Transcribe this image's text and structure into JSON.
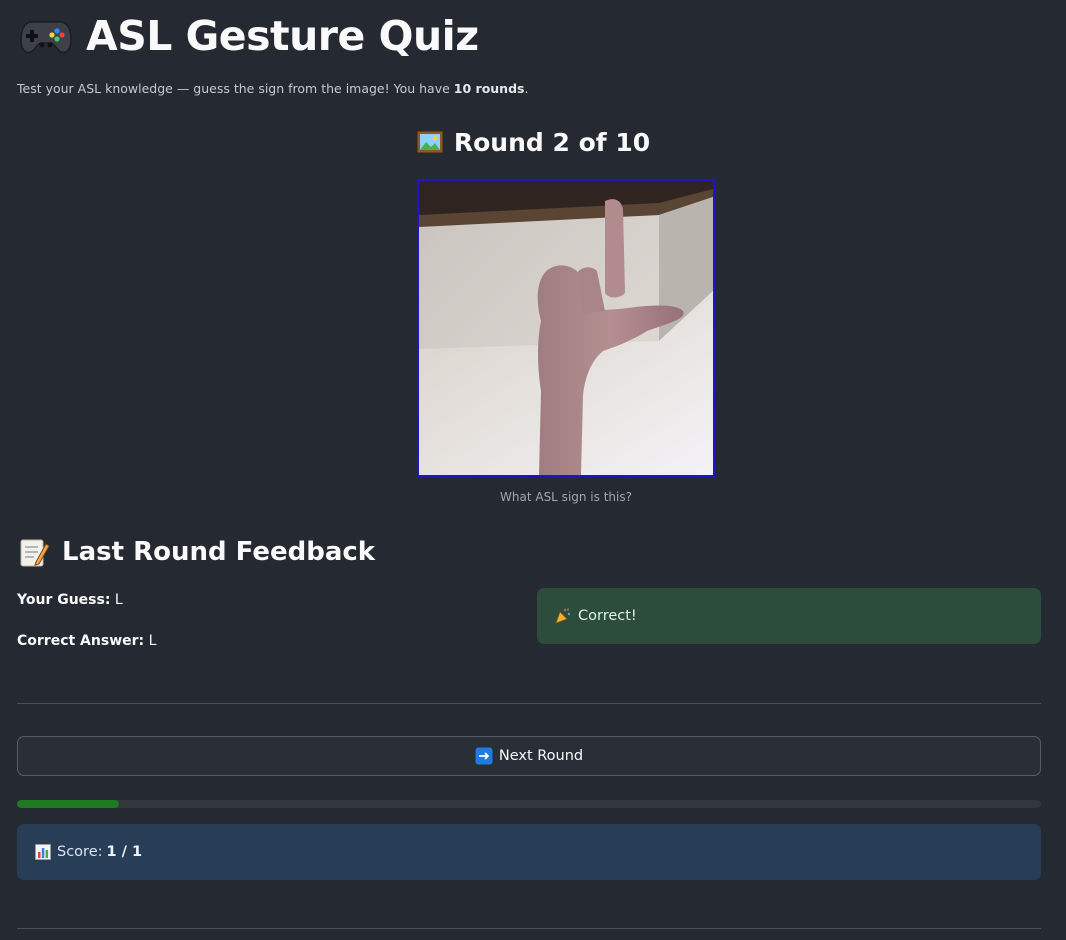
{
  "header": {
    "title": "ASL Gesture Quiz",
    "icon": "game-controller-icon",
    "subtitle_prefix": "Test your ASL knowledge — guess the sign from the image! You have ",
    "subtitle_rounds": "10 rounds",
    "subtitle_suffix": "."
  },
  "round": {
    "icon": "framed-picture-icon",
    "heading": "Round 2 of 10",
    "caption": "What ASL sign is this?"
  },
  "feedback": {
    "icon": "memo-icon",
    "heading": "Last Round Feedback",
    "guess_label": "Your Guess:",
    "guess_value": "L",
    "answer_label": "Correct Answer:",
    "answer_value": "L",
    "result_icon": "party-popper-icon",
    "result_text": "Correct!"
  },
  "actions": {
    "next_icon": "right-arrow-icon",
    "next_label": "Next Round"
  },
  "progress": {
    "fraction": 0.1
  },
  "score": {
    "icon": "bar-chart-icon",
    "label": "Score:",
    "value": "1 / 1"
  },
  "colors": {
    "background": "#252931",
    "success_bg": "#2c4d3b",
    "info_bg": "#283d56",
    "progress_fill": "#1f7a1f"
  }
}
